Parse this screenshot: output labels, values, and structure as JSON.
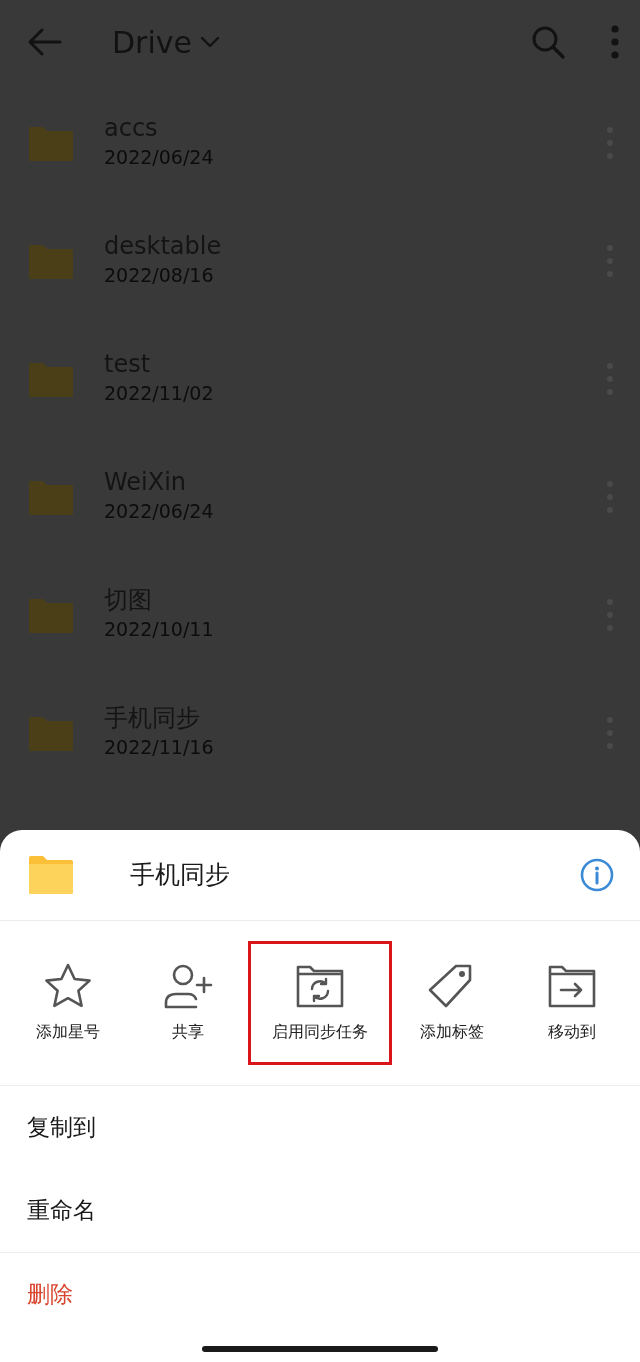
{
  "app_bar": {
    "title": "Drive"
  },
  "files": [
    {
      "name": "accs",
      "date": "2022/06/24"
    },
    {
      "name": "desktable",
      "date": "2022/08/16"
    },
    {
      "name": "test",
      "date": "2022/11/02"
    },
    {
      "name": "WeiXin",
      "date": "2022/06/24"
    },
    {
      "name": "切图",
      "date": "2022/10/11"
    },
    {
      "name": "手机同步",
      "date": "2022/11/16"
    }
  ],
  "sheet": {
    "title": "手机同步",
    "actions": [
      {
        "kind": "star",
        "label": "添加星号",
        "highlighted": false
      },
      {
        "kind": "share",
        "label": "共享",
        "highlighted": false
      },
      {
        "kind": "sync",
        "label": "启用同步任务",
        "highlighted": true
      },
      {
        "kind": "tag",
        "label": "添加标签",
        "highlighted": false
      },
      {
        "kind": "move",
        "label": "移动到",
        "highlighted": false
      }
    ],
    "menu": [
      {
        "label": "复制到",
        "kind": "normal"
      },
      {
        "label": "重命名",
        "kind": "normal"
      },
      {
        "label": "删除",
        "kind": "danger"
      }
    ]
  }
}
